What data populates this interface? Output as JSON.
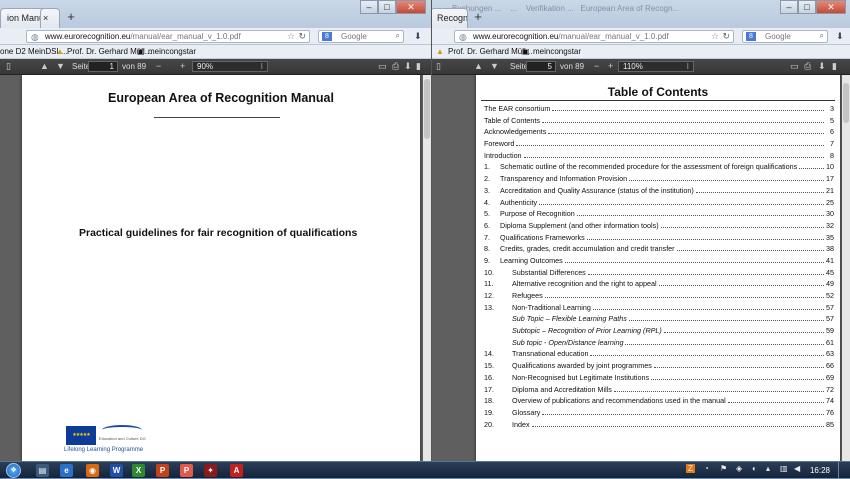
{
  "left_window": {
    "tab_title": "ion Manual - ...",
    "url_domain": "www.eurorecognition.eu",
    "url_path": "/manual/ear_manual_v_1.0.pdf",
    "search_placeholder": "Google",
    "bookmarks": [
      "one D2 MeinDSL...",
      "Prof. Dr. Gerhard Müll...",
      "meincongstar"
    ],
    "pdf_toolbar": {
      "page_label": "Seite:",
      "page": "1",
      "of_label": "von 89",
      "zoom": "90%"
    },
    "doc": {
      "title": "European Area of Recognition Manual",
      "subtitle": "Practical guidelines for fair recognition of qualifications",
      "footer_program": "Lifelong Learning Programme",
      "ec_text": "Education and Culture DG"
    }
  },
  "right_window": {
    "tab_title": "Recognition Manual - ...",
    "url_domain": "www.eurorecognition.eu",
    "url_path": "/manual/ear_manual_v_1.0.pdf",
    "search_placeholder": "Google",
    "bookmarks": [
      "Prof. Dr. Gerhard Müll...",
      "meincongstar"
    ],
    "pdf_toolbar": {
      "page_label": "Seite:",
      "page": "5",
      "of_label": "von 89",
      "zoom": "110%"
    },
    "toc_title": "Table of Contents",
    "toc": [
      {
        "num": "",
        "title": "The EAR consortium",
        "page": "3",
        "level": "top"
      },
      {
        "num": "",
        "title": "Table of Contents",
        "page": "5",
        "level": "top"
      },
      {
        "num": "",
        "title": "Acknowledgements",
        "page": "6",
        "level": "top"
      },
      {
        "num": "",
        "title": "Foreword",
        "page": "7",
        "level": "top"
      },
      {
        "num": "",
        "title": "Introduction",
        "page": "8",
        "level": "top"
      },
      {
        "num": "1.",
        "title": "Schematic outline of the recommended procedure for the assessment of foreign qualifications",
        "page": "10",
        "level": "main"
      },
      {
        "num": "2.",
        "title": "Transparency and Information Provision",
        "page": "17",
        "level": "main"
      },
      {
        "num": "3.",
        "title": "Accreditation and Quality Assurance (status of the institution)",
        "page": "21",
        "level": "main"
      },
      {
        "num": "4.",
        "title": "Authenticity",
        "page": "25",
        "level": "main"
      },
      {
        "num": "5.",
        "title": "Purpose of Recognition",
        "page": "30",
        "level": "main"
      },
      {
        "num": "6.",
        "title": "Diploma Supplement (and other information tools)",
        "page": "32",
        "level": "main"
      },
      {
        "num": "7.",
        "title": "Qualifications Frameworks",
        "page": "35",
        "level": "main"
      },
      {
        "num": "8.",
        "title": "Credits, grades, credit accumulation and credit transfer",
        "page": "38",
        "level": "main"
      },
      {
        "num": "9.",
        "title": "Learning Outcomes",
        "page": "41",
        "level": "main"
      },
      {
        "num": "10.",
        "title": "Substantial Differences",
        "page": "45",
        "level": "sub"
      },
      {
        "num": "11.",
        "title": "Alternative recognition and the right to appeal",
        "page": "49",
        "level": "sub"
      },
      {
        "num": "12.",
        "title": "Refugees",
        "page": "52",
        "level": "sub"
      },
      {
        "num": "13.",
        "title": "Non-Traditional Learning",
        "page": "57",
        "level": "sub"
      },
      {
        "num": "",
        "title": "Sub Topic – Flexible Learning Paths",
        "page": "57",
        "level": "subsub"
      },
      {
        "num": "",
        "title": "Subtopic – Recognition of Prior Learning (RPL)",
        "page": "59",
        "level": "subsub"
      },
      {
        "num": "",
        "title": "Sub topic - Open/Distance learning",
        "page": "61",
        "level": "subsub"
      },
      {
        "num": "14.",
        "title": "Transnational education",
        "page": "63",
        "level": "sub"
      },
      {
        "num": "15.",
        "title": "Qualifications awarded by joint programmes",
        "page": "66",
        "level": "sub"
      },
      {
        "num": "16.",
        "title": "Non-Recognised but Legitimate Institutions",
        "page": "69",
        "level": "sub"
      },
      {
        "num": "17.",
        "title": "Diploma and Accreditation Mills",
        "page": "72",
        "level": "sub"
      },
      {
        "num": "18.",
        "title": "Overview of publications and recommendations used in the manual",
        "page": "74",
        "level": "sub"
      },
      {
        "num": "19.",
        "title": "Glossary",
        "page": "76",
        "level": "sub"
      },
      {
        "num": "20.",
        "title": "Index",
        "page": "85",
        "level": "sub"
      }
    ]
  },
  "taskbar": {
    "clock": "16:28"
  },
  "colors": {
    "pdf_toolbar": "#3f3f3f",
    "viewer_bg": "#5f5f5f",
    "taskbar": "#1c2d44"
  }
}
